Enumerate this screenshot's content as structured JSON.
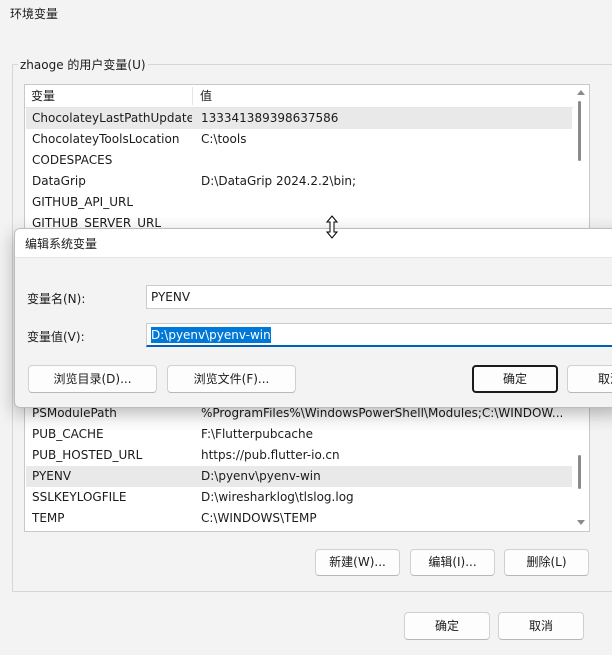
{
  "window": {
    "title": "环境变量"
  },
  "user_vars": {
    "group_label": "zhaoge 的用户变量(U)",
    "columns": [
      "变量",
      "值"
    ],
    "rows_top": [
      {
        "name": "ChocolateyLastPathUpdate",
        "value": "133341389398637586"
      },
      {
        "name": "ChocolateyToolsLocation",
        "value": "C:\\tools"
      },
      {
        "name": "CODESPACES",
        "value": ""
      },
      {
        "name": "DataGrip",
        "value": "D:\\DataGrip 2024.2.2\\bin;"
      },
      {
        "name": "GITHUB_API_URL",
        "value": ""
      },
      {
        "name": "GITHUB_SERVER_URL",
        "value": ""
      }
    ],
    "rows_bottom": [
      {
        "name": "PSModulePath",
        "value": "%ProgramFiles%\\WindowsPowerShell\\Modules;C:\\WINDOW..."
      },
      {
        "name": "PUB_CACHE",
        "value": "F:\\Flutterpubcache"
      },
      {
        "name": "PUB_HOSTED_URL",
        "value": "https://pub.flutter-io.cn"
      },
      {
        "name": "PYENV",
        "value": "D:\\pyenv\\pyenv-win"
      },
      {
        "name": "SSLKEYLOGFILE",
        "value": "D:\\wiresharklog\\tlslog.log"
      },
      {
        "name": "TEMP",
        "value": "C:\\WINDOWS\\TEMP"
      }
    ],
    "buttons": {
      "new": "新建(W)...",
      "edit": "编辑(I)...",
      "delete": "删除(L)"
    }
  },
  "footer": {
    "ok": "确定",
    "cancel": "取消"
  },
  "dialog": {
    "title": "编辑系统变量",
    "name_label": "变量名(N):",
    "name_value": "PYENV",
    "value_label": "变量值(V):",
    "value_value": "D:\\pyenv\\pyenv-win",
    "browse_dir": "浏览目录(D)...",
    "browse_file": "浏览文件(F)...",
    "ok": "确定",
    "cancel_partial": "取消"
  },
  "colors": {
    "selection": "#0078d7",
    "focus_underline": "#005fb8"
  },
  "icons": {
    "cursor": "vertical-resize-cursor-icon"
  }
}
